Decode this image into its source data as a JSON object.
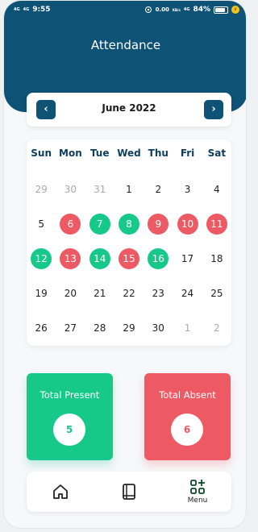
{
  "status_bar": {
    "time": "9:55",
    "network_left": "4G",
    "network_left2": "4G",
    "speed": "0.00",
    "speed_unit": "KB/s",
    "network_right": "4G",
    "battery": "84%",
    "battery_level": 0.84
  },
  "header": {
    "title": "Attendance"
  },
  "month_nav": {
    "month": "June 2022",
    "prev_icon": "chevron-left-icon",
    "next_icon": "chevron-right-icon"
  },
  "calendar": {
    "weekdays": [
      "Sun",
      "Mon",
      "Tue",
      "Wed",
      "Thu",
      "Fri",
      "Sat"
    ],
    "days": [
      {
        "d": "29",
        "s": "muted"
      },
      {
        "d": "30",
        "s": "muted"
      },
      {
        "d": "31",
        "s": "muted"
      },
      {
        "d": "1",
        "s": ""
      },
      {
        "d": "2",
        "s": ""
      },
      {
        "d": "3",
        "s": ""
      },
      {
        "d": "4",
        "s": ""
      },
      {
        "d": "5",
        "s": ""
      },
      {
        "d": "6",
        "s": "absent"
      },
      {
        "d": "7",
        "s": "present"
      },
      {
        "d": "8",
        "s": "present"
      },
      {
        "d": "9",
        "s": "absent"
      },
      {
        "d": "10",
        "s": "absent"
      },
      {
        "d": "11",
        "s": "absent"
      },
      {
        "d": "12",
        "s": "present"
      },
      {
        "d": "13",
        "s": "absent"
      },
      {
        "d": "14",
        "s": "present"
      },
      {
        "d": "15",
        "s": "absent"
      },
      {
        "d": "16",
        "s": "present"
      },
      {
        "d": "17",
        "s": ""
      },
      {
        "d": "18",
        "s": ""
      },
      {
        "d": "19",
        "s": ""
      },
      {
        "d": "20",
        "s": ""
      },
      {
        "d": "21",
        "s": ""
      },
      {
        "d": "22",
        "s": ""
      },
      {
        "d": "23",
        "s": ""
      },
      {
        "d": "24",
        "s": ""
      },
      {
        "d": "25",
        "s": ""
      },
      {
        "d": "26",
        "s": ""
      },
      {
        "d": "27",
        "s": ""
      },
      {
        "d": "28",
        "s": ""
      },
      {
        "d": "29",
        "s": ""
      },
      {
        "d": "30",
        "s": ""
      },
      {
        "d": "1",
        "s": "muted"
      },
      {
        "d": "2",
        "s": "muted"
      }
    ]
  },
  "summary": {
    "present_label": "Total Present",
    "present_count": "5",
    "absent_label": "Total Absent",
    "absent_count": "6"
  },
  "bottom_nav": {
    "home_icon": "home-icon",
    "book_icon": "book-icon",
    "menu_icon": "grid-plus-icon",
    "menu_label": "Menu"
  },
  "colors": {
    "primary": "#0e5276",
    "present": "#16c98b",
    "absent": "#ee5a64"
  }
}
